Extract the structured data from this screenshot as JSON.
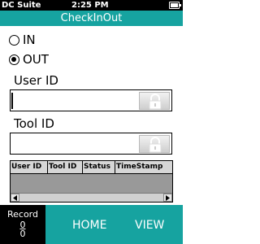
{
  "status_bar": {
    "app": "DC Suite",
    "time": "2:25 PM"
  },
  "title": "CheckInOut",
  "direction": {
    "options": [
      {
        "label": "IN",
        "selected": false
      },
      {
        "label": "OUT",
        "selected": true
      }
    ]
  },
  "user_id": {
    "label": "User ID",
    "value": ""
  },
  "tool_id": {
    "label": "Tool ID",
    "value": ""
  },
  "grid": {
    "columns": [
      "User ID",
      "Tool ID",
      "Status",
      "TimeStamp"
    ],
    "rows": []
  },
  "bottom_bar": {
    "record_label": "Record",
    "record_count_top": "0",
    "record_count_bottom": "0",
    "home_label": "HOME",
    "view_label": "VIEW"
  },
  "colors": {
    "accent": "#16a3a0",
    "statusbar": "#000000",
    "grid_fill": "#999999"
  },
  "icons": {
    "lock": "lock-icon",
    "battery": "battery-icon"
  }
}
